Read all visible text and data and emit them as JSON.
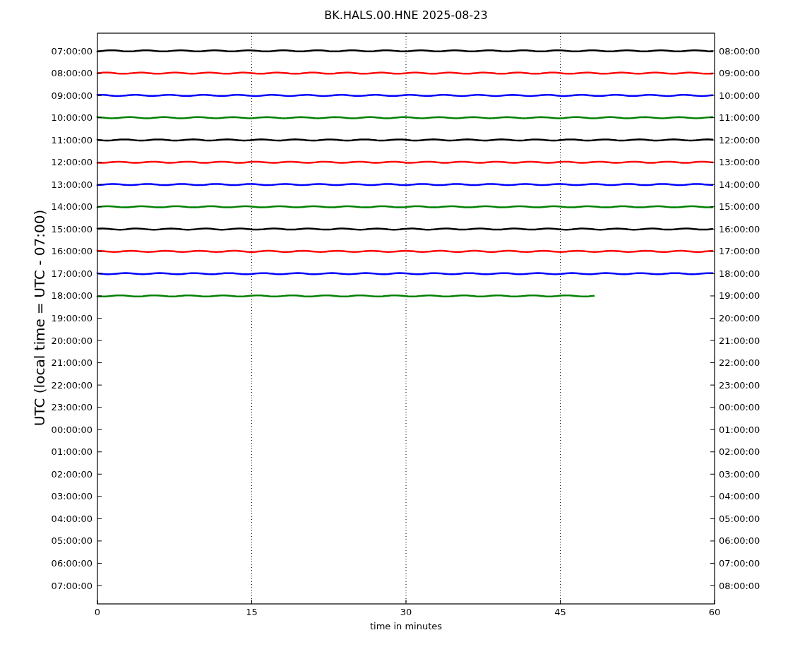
{
  "plot": {
    "title": "BK.HALS.00.HNE 2025-08-23",
    "ylabel": "UTC (local time = UTC - 07:00)",
    "xlabel": "time in minutes",
    "xticks": [
      "0",
      "15",
      "30",
      "45",
      "60"
    ],
    "left_labels": [
      "07:00:00",
      "08:00:00",
      "09:00:00",
      "10:00:00",
      "11:00:00",
      "12:00:00",
      "13:00:00",
      "14:00:00",
      "15:00:00",
      "16:00:00",
      "17:00:00",
      "18:00:00",
      "19:00:00",
      "20:00:00",
      "21:00:00",
      "22:00:00",
      "23:00:00",
      "00:00:00",
      "01:00:00",
      "02:00:00",
      "03:00:00",
      "04:00:00",
      "05:00:00",
      "06:00:00",
      "07:00:00"
    ],
    "right_labels": [
      "08:00:00",
      "09:00:00",
      "10:00:00",
      "11:00:00",
      "12:00:00",
      "13:00:00",
      "14:00:00",
      "15:00:00",
      "16:00:00",
      "17:00:00",
      "18:00:00",
      "19:00:00",
      "20:00:00",
      "21:00:00",
      "22:00:00",
      "23:00:00",
      "00:00:00",
      "01:00:00",
      "02:00:00",
      "03:00:00",
      "04:00:00",
      "05:00:00",
      "06:00:00",
      "07:00:00",
      "08:00:00"
    ],
    "traces": [
      {
        "color": "#000000",
        "level": 1
      },
      {
        "color": "#ff0000",
        "level": 1
      },
      {
        "color": "#0000ff",
        "level": 1
      },
      {
        "color": "#008000",
        "level": 1
      },
      {
        "color": "#000000",
        "level": 1
      },
      {
        "color": "#ff0000",
        "level": 1
      },
      {
        "color": "#0000ff",
        "level": 1
      },
      {
        "color": "#008000",
        "level": 1
      },
      {
        "color": "#000000",
        "level": 1
      },
      {
        "color": "#ff0000",
        "level": 1
      },
      {
        "color": "#0000ff",
        "level": 1
      },
      {
        "color": "#008000",
        "level": 0.808
      }
    ]
  }
}
